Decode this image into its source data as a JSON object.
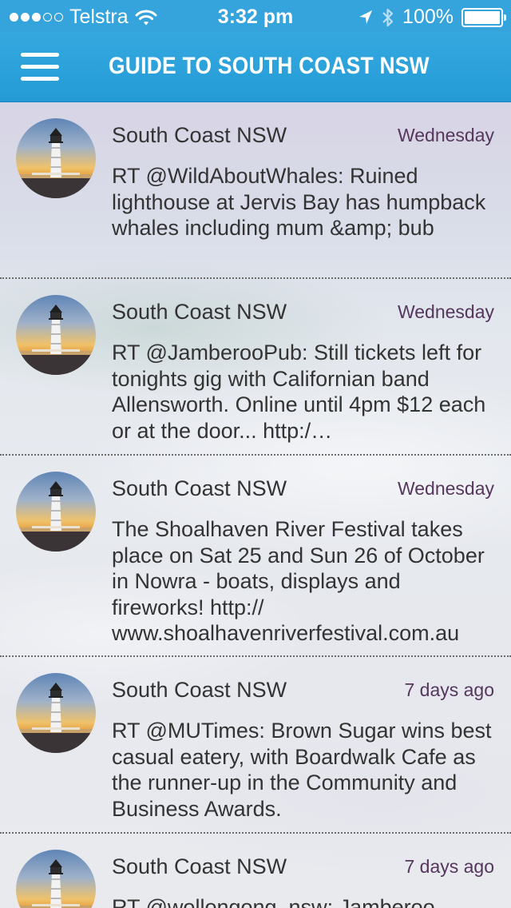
{
  "status_bar": {
    "carrier": "Telstra",
    "time": "3:32 pm",
    "battery": "100%",
    "signal_bars_filled": 3,
    "signal_bars_total": 5,
    "battery_level": 1.0
  },
  "nav": {
    "title": "GUIDE TO SOUTH COAST NSW",
    "menu_icon": "hamburger-menu-icon"
  },
  "colors": {
    "accent": "#2ba0d9",
    "timestamp": "#55365d",
    "text": "#333333"
  },
  "feed": [
    {
      "author": "South Coast NSW",
      "time": "Wednesday",
      "text": "RT @WildAboutWhales: Ruined lighthouse at Jervis Bay has humpback whales including mum &amp; bub"
    },
    {
      "author": "South Coast NSW",
      "time": "Wednesday",
      "text": "RT @JamberooPub: Still tickets left for tonights gig with Californian band Allensworth.  Online until 4pm $12 each or at the door... http:/…"
    },
    {
      "author": "South Coast NSW",
      "time": "Wednesday",
      "text": "The Shoalhaven River Festival takes place on Sat 25 and Sun 26 of October in Nowra - boats, displays and fireworks! http:// www.shoalhavenriverfestival.com.au"
    },
    {
      "author": "South Coast NSW",
      "time": "7 days ago",
      "text": "RT @MUTimes: Brown Sugar wins best casual eatery, with Boardwalk Cafe as the runner-up in the Community and Business Awards."
    },
    {
      "author": "South Coast NSW",
      "time": "7 days ago",
      "text": "RT @wollongong_nsw: Jamberoo"
    }
  ]
}
